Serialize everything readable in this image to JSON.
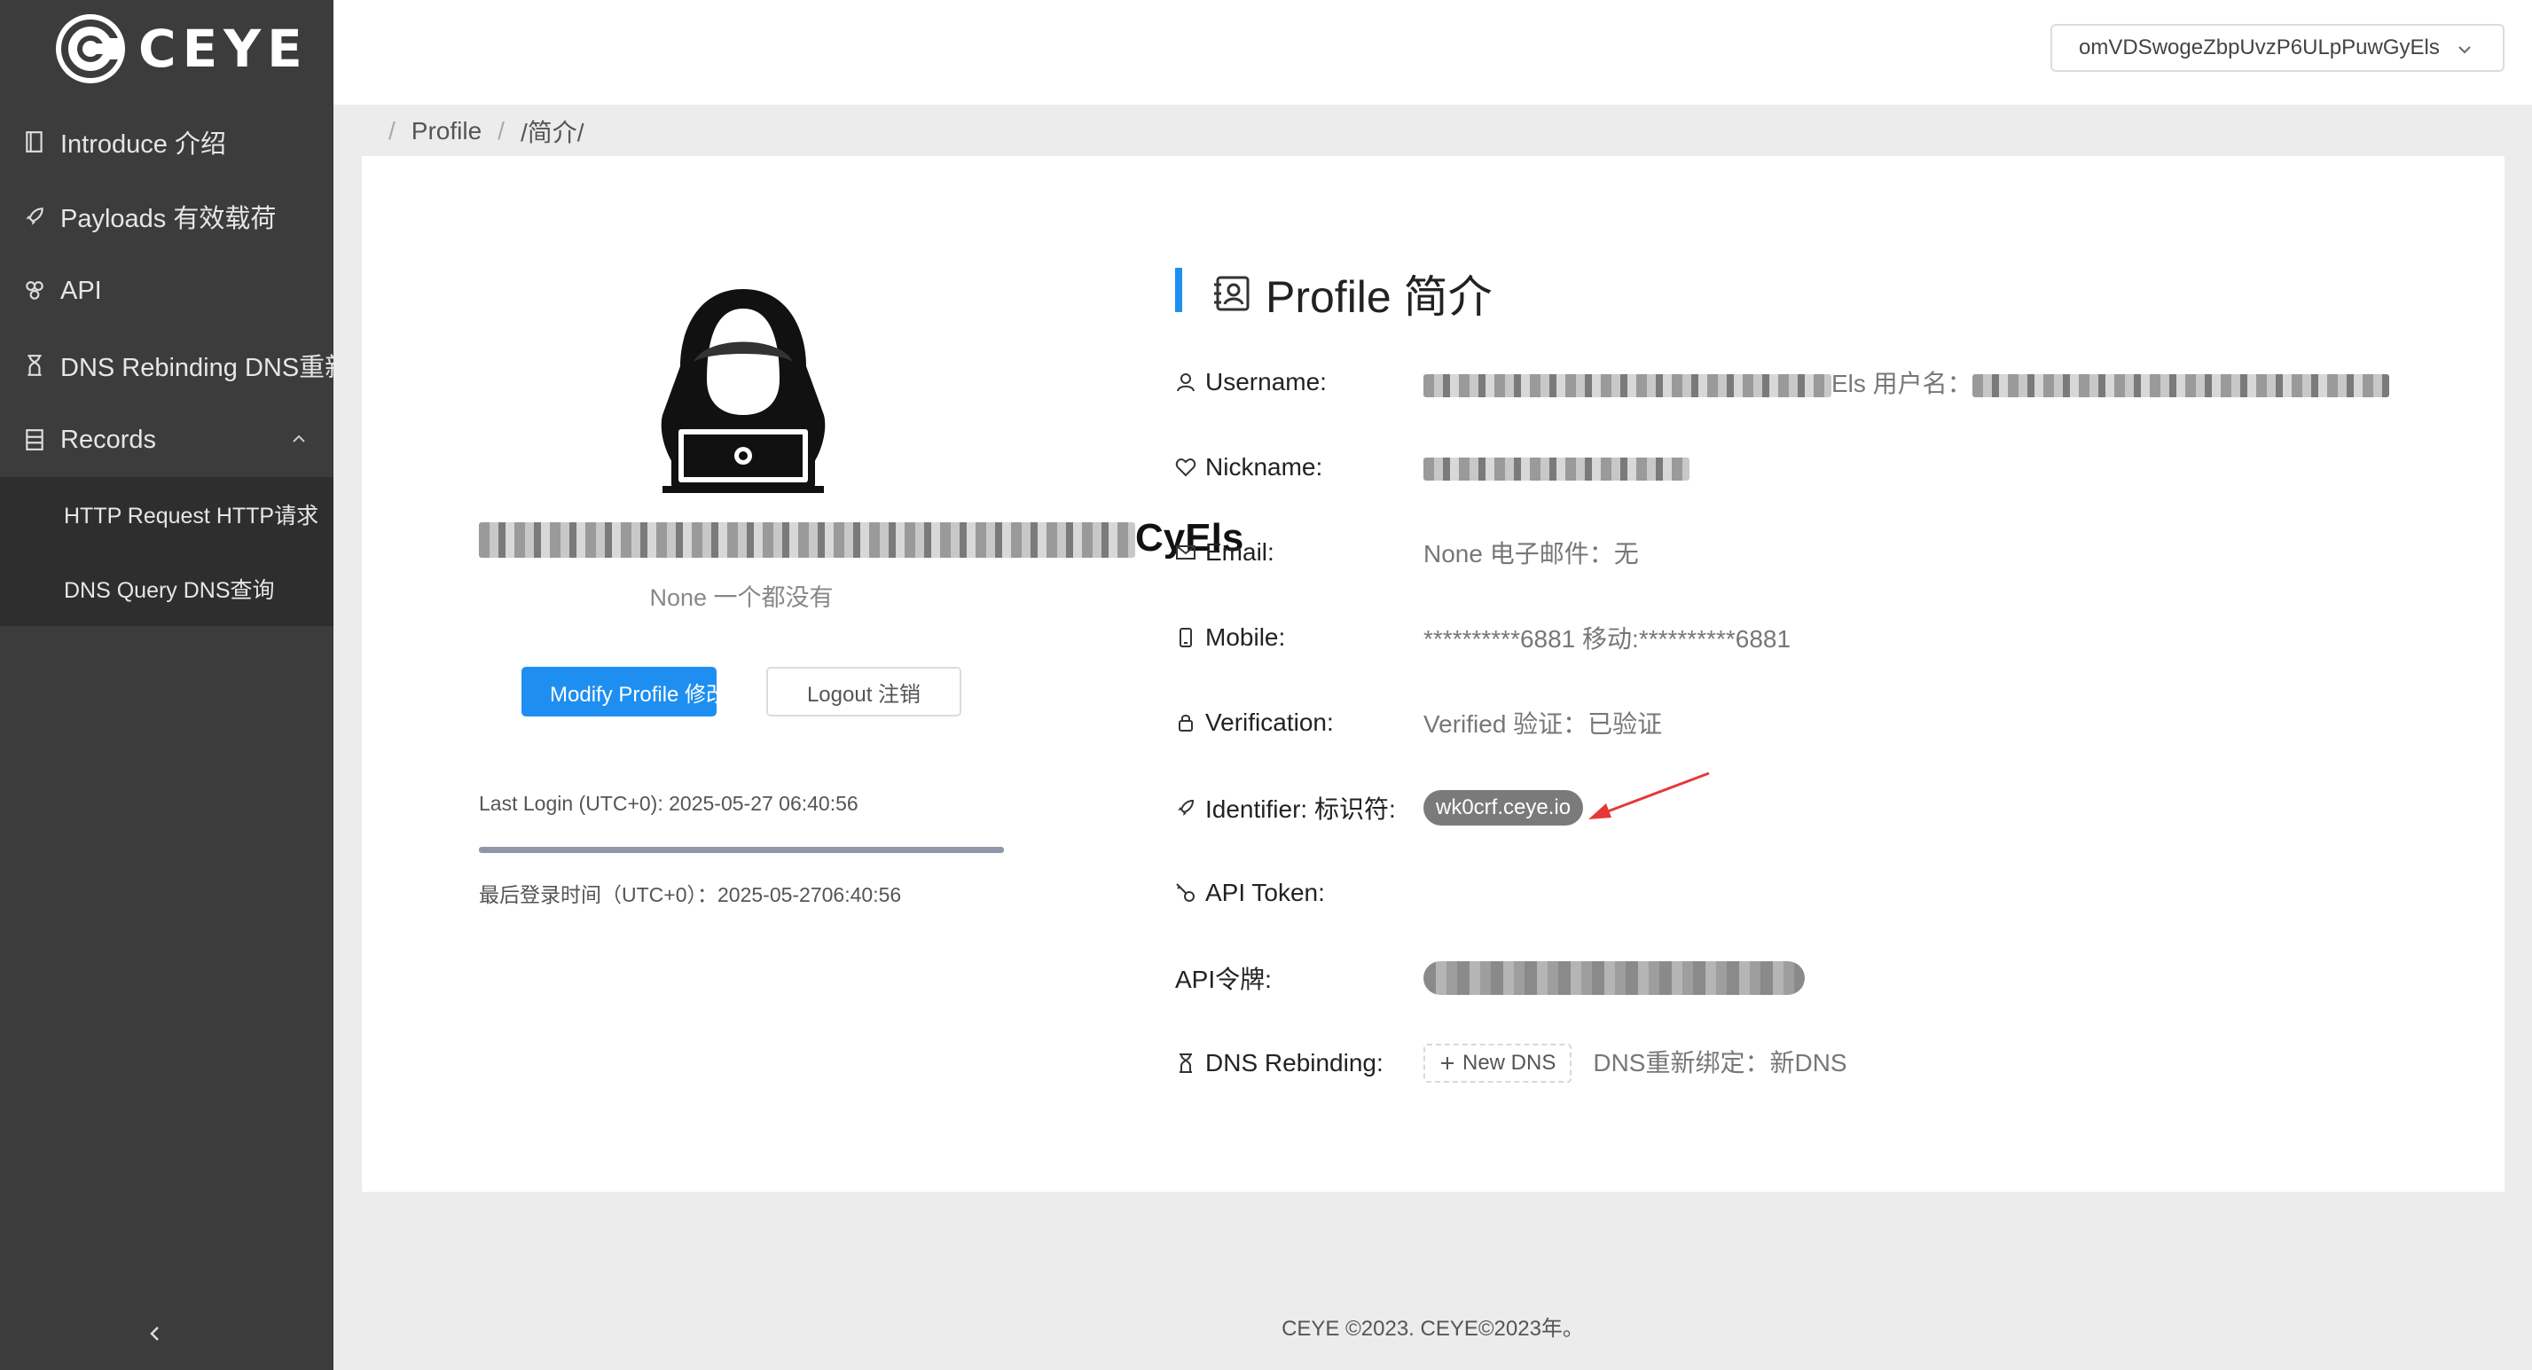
{
  "sidebar": {
    "logo_text": "CEYE",
    "items": [
      {
        "label": "Introduce 介绍",
        "icon": "book-icon"
      },
      {
        "label": "Payloads 有效载荷",
        "icon": "rocket-icon"
      },
      {
        "label": "API",
        "icon": "api-icon"
      },
      {
        "label": "DNS Rebinding DNS重新",
        "icon": "hourglass-icon"
      },
      {
        "label": "Records",
        "icon": "database-icon",
        "expanded": true
      }
    ],
    "submenu": [
      {
        "label": "HTTP Request HTTP请求"
      },
      {
        "label": "DNS Query DNS查询"
      }
    ]
  },
  "topbar": {
    "user_select_value": "omVDSwogeZbpUvzP6ULpPuwGyEls"
  },
  "breadcrumb": {
    "items": [
      "Profile",
      "/简介/"
    ]
  },
  "profile": {
    "name_visible_suffix": "CyEls",
    "nickname_sub": "None 一个都没有",
    "modify_button": "Modify Profile 修改",
    "logout_button": "Logout 注销",
    "last_login": "Last Login (UTC+0): 2025-05-27 06:40:56",
    "last_login_cn": "最后登录时间（UTC+0）：2025-05-2706:40:56",
    "progress_percent": 100
  },
  "details": {
    "title": "Profile 简介",
    "fields": {
      "username": {
        "label": "Username:",
        "value_visible": "Els 用户名："
      },
      "nickname": {
        "label": "Nickname:"
      },
      "email": {
        "label": "Email:",
        "value": "None 电子邮件：无"
      },
      "mobile": {
        "label": "Mobile:",
        "value": "**********6881 移动:**********6881"
      },
      "verification": {
        "label": "Verification:",
        "value": "Verified 验证：已验证"
      },
      "identifier": {
        "label": "Identifier: 标识符:",
        "value": "wk0crf.ceye.io"
      },
      "api_token": {
        "label": "API Token:"
      },
      "api_token_cn": {
        "label": "API令牌:"
      },
      "dns_rebinding": {
        "label": "DNS Rebinding:",
        "button": "New DNS",
        "value": "DNS重新绑定：新DNS"
      }
    }
  },
  "footer": {
    "text": "CEYE ©2023. CEYE©2023年。"
  },
  "colors": {
    "accent": "#1e8ff0",
    "sidebar_bg": "#3c3c3c",
    "arrow": "#e53935"
  }
}
